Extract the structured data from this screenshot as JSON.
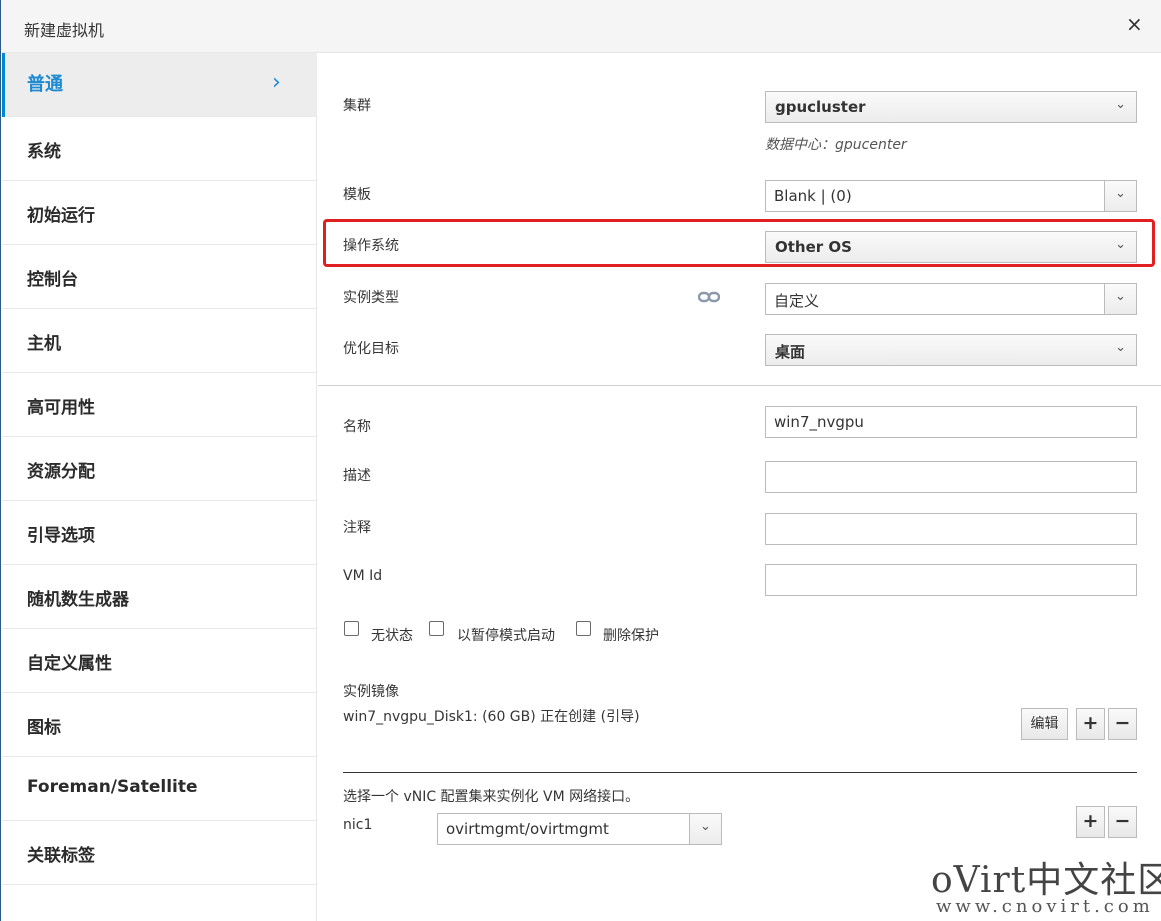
{
  "dialog": {
    "title": "新建虚拟机",
    "close_glyph": "×"
  },
  "sidebar": {
    "items": [
      {
        "label": "普通",
        "active": true
      },
      {
        "label": "系统"
      },
      {
        "label": "初始运行"
      },
      {
        "label": "控制台"
      },
      {
        "label": "主机"
      },
      {
        "label": "高可用性"
      },
      {
        "label": "资源分配"
      },
      {
        "label": "引导选项"
      },
      {
        "label": "随机数生成器"
      },
      {
        "label": "自定义属性"
      },
      {
        "label": "图标"
      },
      {
        "label": "Foreman/Satellite"
      },
      {
        "label": "关联标签"
      }
    ],
    "active_chevron": "›"
  },
  "form": {
    "cluster": {
      "label": "集群",
      "value": "gpucluster",
      "hint": "数据中心：gpucenter"
    },
    "template": {
      "label": "模板",
      "value": "Blank |  (0)"
    },
    "os": {
      "label": "操作系统",
      "value": "Other OS"
    },
    "instance_type": {
      "label": "实例类型",
      "value": "自定义"
    },
    "optimize": {
      "label": "优化目标",
      "value": "桌面"
    },
    "name": {
      "label": "名称",
      "value": "win7_nvgpu"
    },
    "description": {
      "label": "描述",
      "value": ""
    },
    "comment": {
      "label": "注释",
      "value": ""
    },
    "vm_id": {
      "label": "VM Id",
      "value": ""
    },
    "checkboxes": {
      "stateless": "无状态",
      "start_paused": "以暂停模式启动",
      "delete_protect": "删除保护"
    },
    "instance_images": {
      "label": "实例镜像",
      "disk": "win7_nvgpu_Disk1: (60 GB) 正在创建 (引导)",
      "edit": "编辑",
      "add": "+",
      "remove": "−"
    },
    "vnic": {
      "instruction": "选择一个 vNIC 配置集来实例化 VM 网络接口。",
      "nic_label": "nic1",
      "nic_value": "ovirtmgmt/ovirtmgmt",
      "add": "+",
      "remove": "−"
    }
  },
  "watermark": {
    "main": "oVirt中文社区",
    "sub": "www.cnovirt.com"
  },
  "colors": {
    "accent": "#1d8ad1",
    "highlight": "#e02020"
  },
  "icons": {
    "dropdown": "chevron-down-icon",
    "link": "link-icon",
    "close": "close-icon"
  }
}
